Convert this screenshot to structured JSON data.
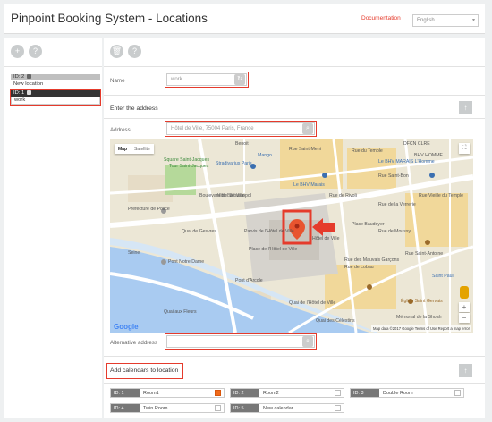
{
  "header": {
    "title": "Pinpoint Booking System - Locations",
    "documentation_link": "Documentation",
    "language": "English"
  },
  "left_toolbar": {
    "add_icon": "plus-icon",
    "help_icon": "question-icon"
  },
  "locations": [
    {
      "id_label": "ID: 2",
      "name": "New location"
    },
    {
      "id_label": "ID: 1",
      "name": "work"
    }
  ],
  "right_toolbar": {
    "delete_icon": "trash-icon",
    "help_icon": "question-icon"
  },
  "form": {
    "name_label": "Name",
    "name_value": "work",
    "address_section": "Enter the address",
    "address_label": "Address",
    "address_value": "Hôtel de Ville, 75004 Paris, France",
    "alt_address_label": "Alternative address",
    "alt_address_value": "",
    "calendars_section": "Add calendars to location"
  },
  "map": {
    "type_map": "Map",
    "type_satellite": "Satellite",
    "labels": [
      "Benoit",
      "Mango",
      "Stradivarius Paris",
      "Square Saint-Jacques",
      "Tour Saint-Jacques",
      "Le BHV Marais",
      "Rue de Rivoli",
      "Rue Saint-Merri",
      "Le BHV MARAIS L'Homme",
      "Prefecture de Police",
      "Parvis de l'Hôtel de Ville",
      "Hôtel de Ville",
      "Place de l'Hôtel de Ville",
      "Pont Notre Dame",
      "Seine",
      "Quai de Gesvres",
      "Pont d'Arcole",
      "Quai de l'Hôtel de Ville",
      "Saint Paul",
      "Église Saint Gervais",
      "Rue Saint-Antoine",
      "Rue de la Verrerie",
      "Rue Saint-Bon",
      "Quai aux Fleurs",
      "Hôtel de Ville",
      "Rue des Mauvais Garçons",
      "Rue de Lobau",
      "Rue de Moussy",
      "DFCN CLRE",
      "BHV HOMME",
      "Place Baudoyer",
      "Boulevard de Sébastopol",
      "Rue du Temple",
      "Mémorial de la Shoah",
      "Quai des Célestins",
      "Rue Vieille du Temple"
    ],
    "footer": "Map data ©2017 Google   Terms of Use   Report a map error",
    "google": "Google"
  },
  "calendars": [
    {
      "id_label": "ID: 1",
      "name": "Room1",
      "checked": true
    },
    {
      "id_label": "ID: 2",
      "name": "Room2",
      "checked": false
    },
    {
      "id_label": "ID: 3",
      "name": "Double Room",
      "checked": false
    },
    {
      "id_label": "ID: 4",
      "name": "Twin Room",
      "checked": false
    },
    {
      "id_label": "ID: 5",
      "name": "New calendar",
      "checked": false
    }
  ],
  "colors": {
    "accent_red": "#e53b2c",
    "checked_orange": "#f06a1a"
  }
}
